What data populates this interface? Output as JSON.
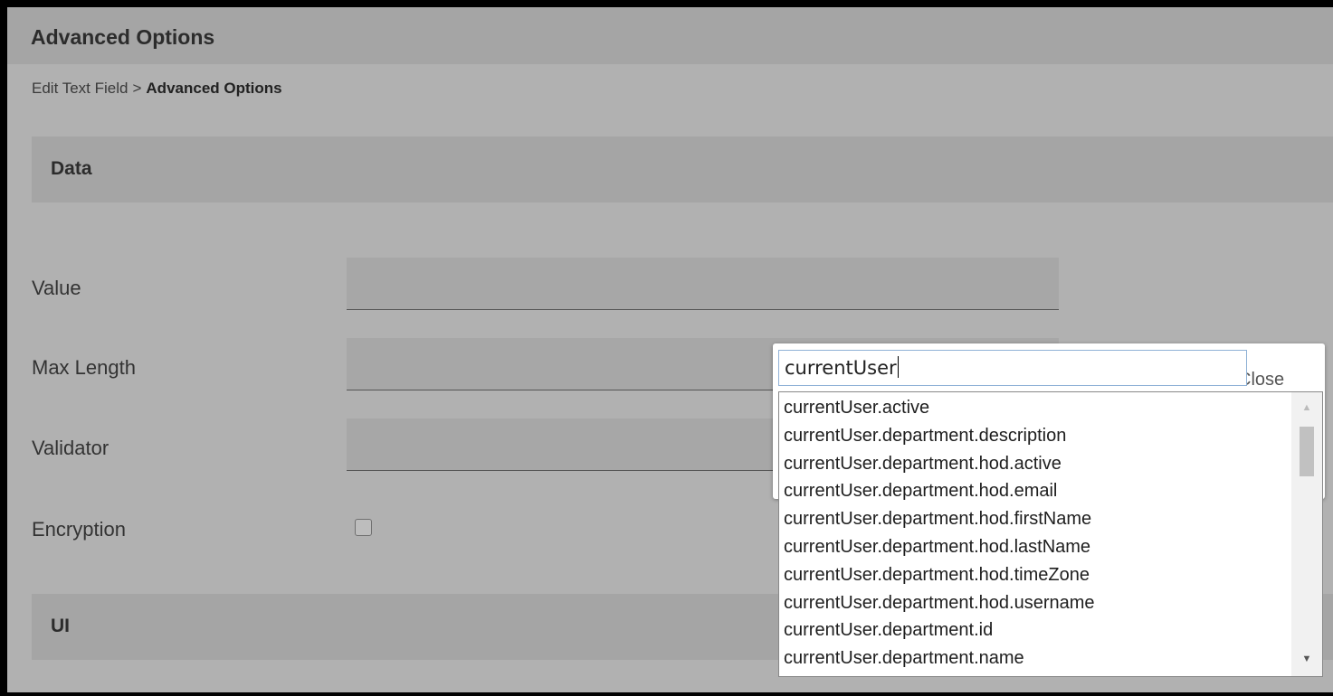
{
  "header": {
    "title": "Advanced Options"
  },
  "breadcrumb": {
    "parent": "Edit Text Field",
    "separator": ">",
    "current": "Advanced Options"
  },
  "sections": {
    "data": "Data",
    "ui": "UI"
  },
  "fields": {
    "value": {
      "label": "Value",
      "value": ""
    },
    "max_length": {
      "label": "Max Length",
      "value": ""
    },
    "validator": {
      "label": "Validator",
      "value": ""
    },
    "encryption": {
      "label": "Encryption",
      "checked": false
    }
  },
  "popup": {
    "input_value": "currentUser",
    "close_label": "Close"
  },
  "suggestions": [
    "currentUser.active",
    "currentUser.department.description",
    "currentUser.department.hod.active",
    "currentUser.department.hod.email",
    "currentUser.department.hod.firstName",
    "currentUser.department.hod.lastName",
    "currentUser.department.hod.timeZone",
    "currentUser.department.hod.username",
    "currentUser.department.id",
    "currentUser.department.name"
  ],
  "icons": {
    "scroll_up": "triangle-up",
    "scroll_down": "triangle-down"
  }
}
